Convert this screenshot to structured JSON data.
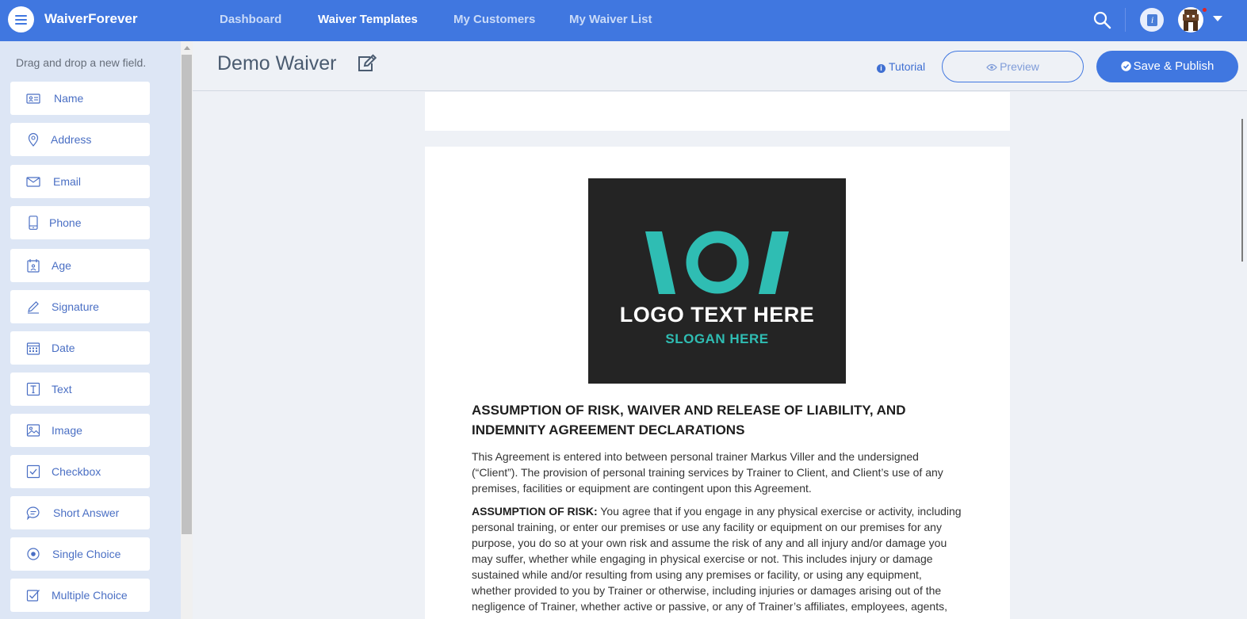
{
  "app": {
    "brand": "WaiverForever",
    "nav": [
      {
        "label": "Dashboard",
        "active": false
      },
      {
        "label": "Waiver Templates",
        "active": true
      },
      {
        "label": "My Customers",
        "active": false
      },
      {
        "label": "My Waiver List",
        "active": false
      }
    ]
  },
  "sidebar": {
    "hint": "Drag and drop a new field.",
    "fields": [
      {
        "label": "Name",
        "icon": "id-card-icon"
      },
      {
        "label": "Address",
        "icon": "map-pin-icon"
      },
      {
        "label": "Email",
        "icon": "envelope-icon"
      },
      {
        "label": "Phone",
        "icon": "phone-icon"
      },
      {
        "label": "Age",
        "icon": "calendar-person-icon"
      },
      {
        "label": "Signature",
        "icon": "pen-icon"
      },
      {
        "label": "Date",
        "icon": "calendar-icon"
      },
      {
        "label": "Text",
        "icon": "text-icon"
      },
      {
        "label": "Image",
        "icon": "image-icon"
      },
      {
        "label": "Checkbox",
        "icon": "checkbox-icon"
      },
      {
        "label": "Short Answer",
        "icon": "chat-icon"
      },
      {
        "label": "Single Choice",
        "icon": "radio-icon"
      },
      {
        "label": "Multiple Choice",
        "icon": "multi-check-icon"
      }
    ]
  },
  "editor": {
    "title": "Demo Waiver",
    "tutorial_label": "Tutorial",
    "preview_label": "Preview",
    "publish_label": "Save & Publish"
  },
  "document": {
    "logo_text": "LOGO TEXT HERE",
    "logo_slogan": "SLOGAN HERE",
    "heading": "ASSUMPTION OF RISK, WAIVER AND RELEASE OF LIABILITY, AND INDEMNITY AGREEMENT DECLARATIONS",
    "paragraph1": "This Agreement is entered into between personal trainer Markus Viller and the undersigned (“Client”). The provision of personal training services by Trainer to Client, and Client’s use of any premises, facilities or equipment are contingent upon this Agreement.",
    "paragraph2_lead": "ASSUMPTION OF RISK:",
    "paragraph2_body": " You agree that if you engage in any physical exercise or activity, including personal training, or enter our premises or use any facility or equipment on our premises for any purpose, you do so at your own risk and assume the risk of any and all injury and/or damage you may suffer, whether while engaging in physical exercise or not. This includes injury or damage sustained while and/or resulting from using any premises or facility, or using any equipment, whether provided to you by Trainer or otherwise, including injuries or damages arising out of the negligence of Trainer, whether active or passive, or any of Trainer’s affiliates, employees, agents,"
  },
  "colors": {
    "topbar": "#4077e0",
    "sidebar": "#dde6f5",
    "accent_teal": "#2fbdb3",
    "link_blue": "#4a6fc4"
  }
}
